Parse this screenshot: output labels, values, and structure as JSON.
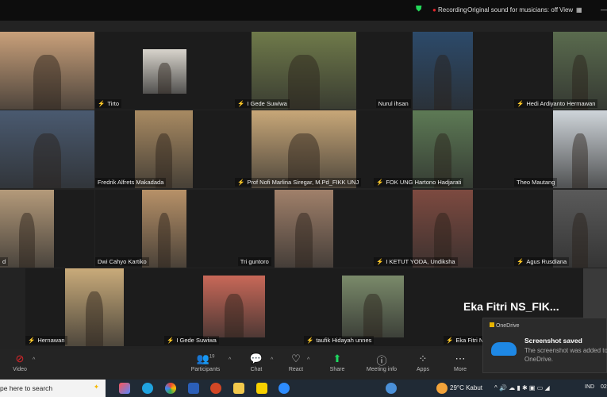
{
  "topbar": {
    "recording": "Recording",
    "original_sound": "Original sound for musicians: off",
    "view": "View"
  },
  "tiles": [
    {
      "name": "",
      "muted": false,
      "active": true
    },
    {
      "name": "Tirto",
      "muted": true
    },
    {
      "name": "I Gede Suwiwa",
      "muted": true
    },
    {
      "name": "Nurul ihsan",
      "muted": false
    },
    {
      "name": "Hedi Ardiyanto Hermawan",
      "muted": true
    },
    {
      "name": "",
      "muted": false
    },
    {
      "name": "Fredrik Alfrets Makadada",
      "muted": false
    },
    {
      "name": "Prof Nofi Marlina Siregar, M.Pd_FIKK UNJ",
      "muted": true
    },
    {
      "name": "FOK UNG  Hartono Hadjarati",
      "muted": true
    },
    {
      "name": "Theo Mautang",
      "muted": false
    },
    {
      "name": "d",
      "muted": false
    },
    {
      "name": "Dwi Cahyo Kartiko",
      "muted": false
    },
    {
      "name": "Tri guntoro",
      "muted": false
    },
    {
      "name": "I KETUT YODA, Undiksha",
      "muted": true
    },
    {
      "name": "Agus Rusdiana",
      "muted": true
    },
    {
      "name": "Hernawan",
      "muted": true
    },
    {
      "name": "I Gede Suwiwa",
      "muted": true
    },
    {
      "name": "taufik Hidayah unnes",
      "muted": true
    },
    {
      "name": "Eka Fitri NS",
      "muted": true,
      "big_name": "Eka Fitri NS_FIK..."
    }
  ],
  "toolbar": {
    "video": "Video",
    "participants": "Participants",
    "participants_count": "19",
    "chat": "Chat",
    "react": "React",
    "share": "Share",
    "meeting_info": "Meeting info",
    "apps": "Apps",
    "more": "More"
  },
  "toast": {
    "app": "OneDrive",
    "title": "Screenshot saved",
    "body": "The screenshot was added to OneDrive."
  },
  "taskbar": {
    "search_placeholder": "pe here to search",
    "weather": "29°C  Kabut",
    "lang": "IND",
    "clock": "02"
  },
  "colors": {
    "active_speaker": "#23d959",
    "muted": "#e0242a",
    "share": "#1ed760"
  }
}
